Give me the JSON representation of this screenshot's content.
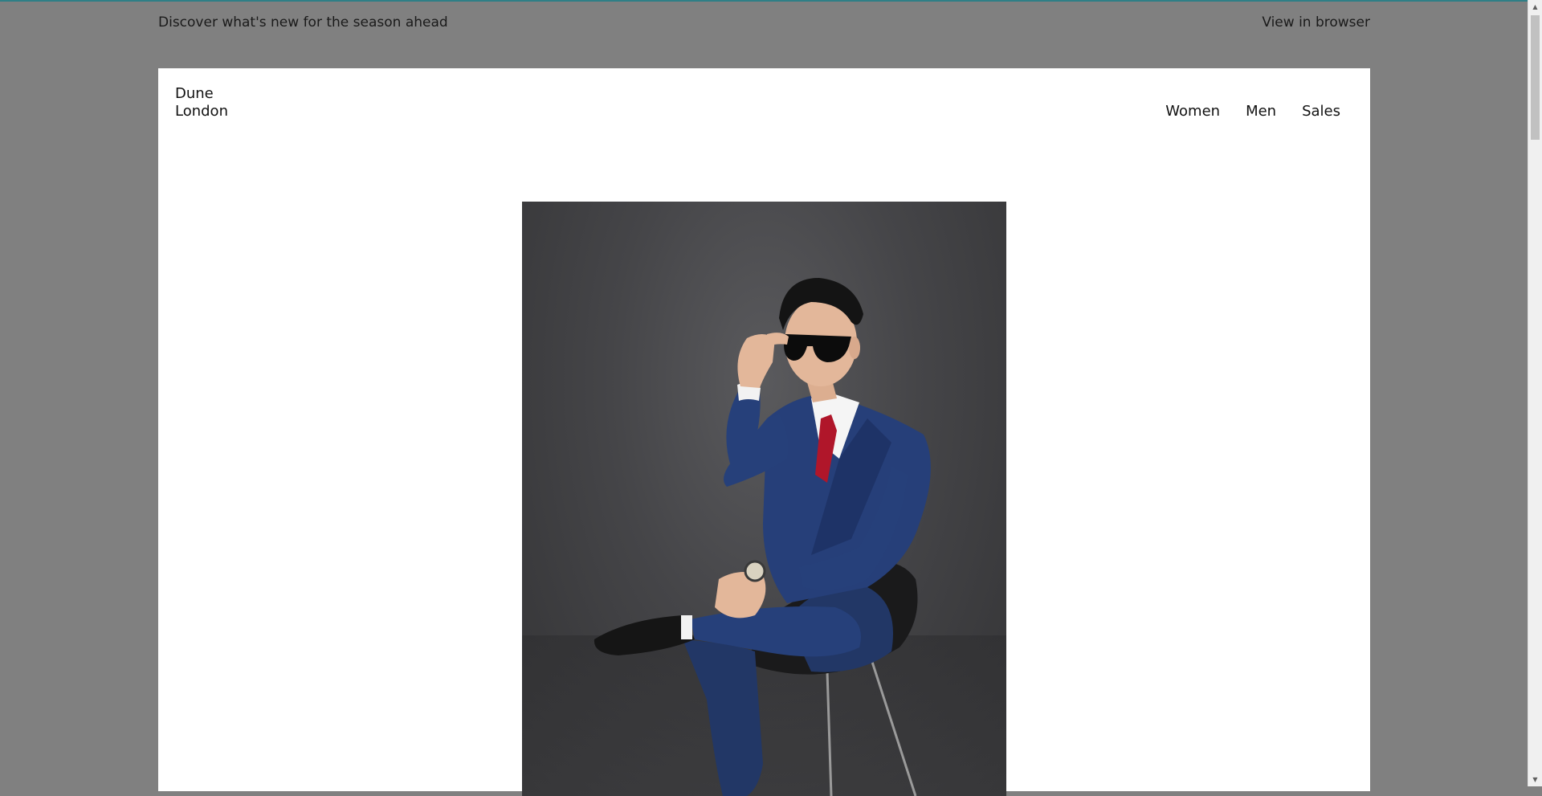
{
  "preheader": {
    "tagline": "Discover what's new for the season ahead",
    "view_in_browser": "View in browser"
  },
  "header": {
    "logo_line1": "Dune",
    "logo_line2": "London",
    "nav": [
      {
        "label": "Women"
      },
      {
        "label": "Men"
      },
      {
        "label": "Sales"
      }
    ]
  },
  "hero": {
    "description": "Man in navy three-piece suit and red tie, adjusting sunglasses, seated on a black stool"
  },
  "colors": {
    "page_bg": "#808080",
    "card_bg": "#ffffff",
    "accent_top": "#2f7f86",
    "suit": "#23386b",
    "tie": "#b0162a"
  },
  "icons": {
    "scroll_up": "scroll-up-arrow-icon",
    "scroll_down": "scroll-down-arrow-icon"
  }
}
